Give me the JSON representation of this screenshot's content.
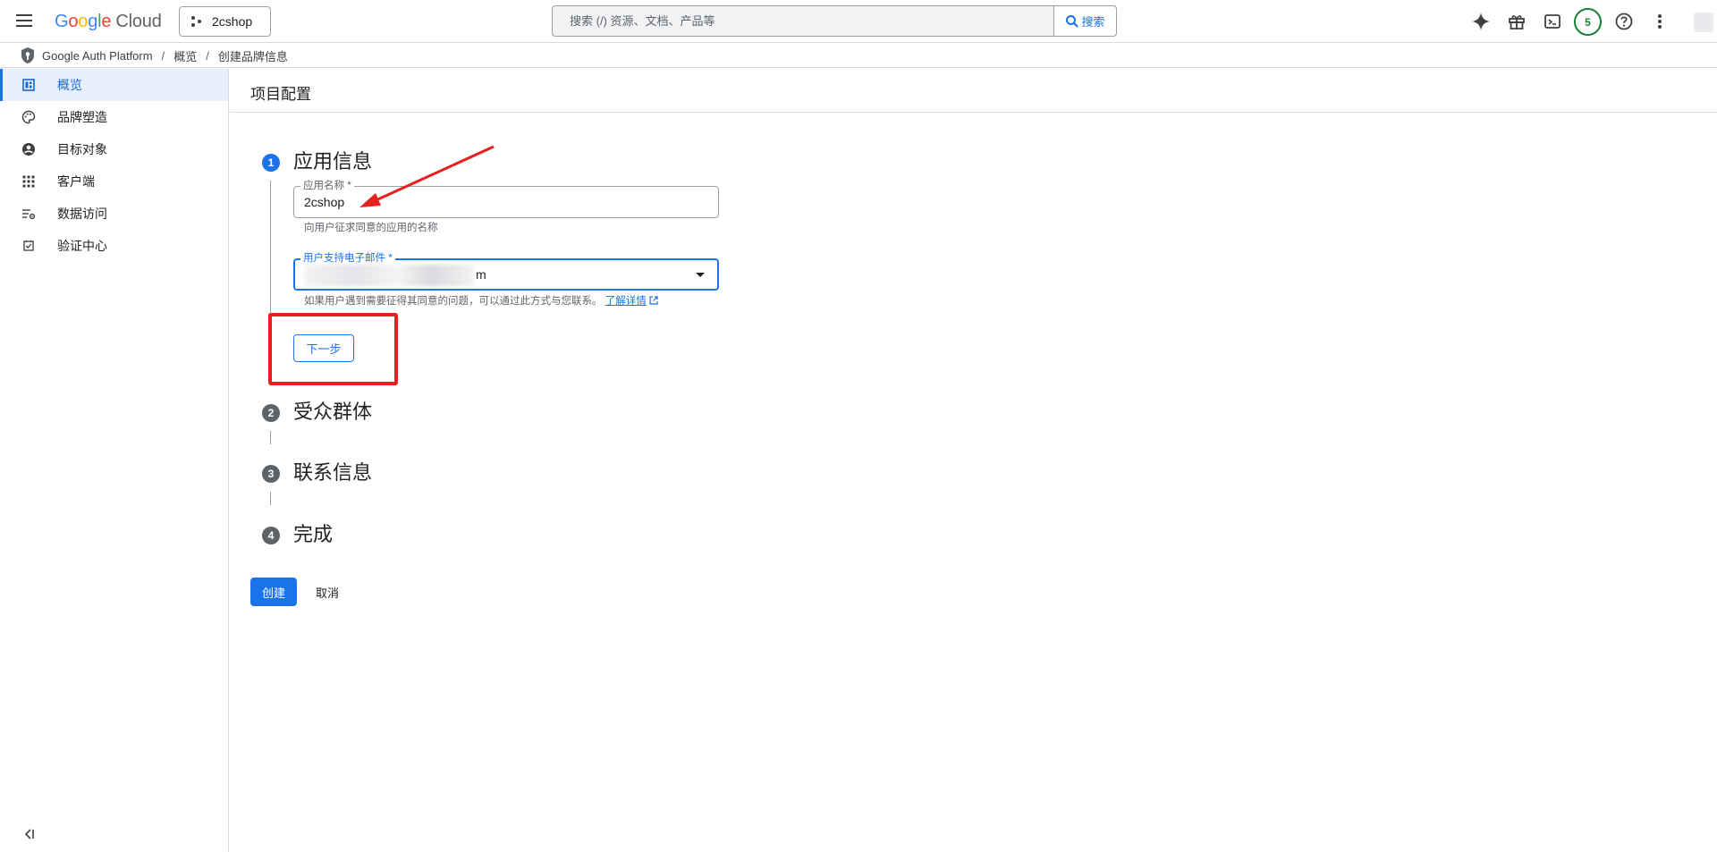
{
  "header": {
    "menu_icon": "hamburger-menu-icon",
    "logo": {
      "word": "Google",
      "suffix": "Cloud"
    },
    "project": "2cshop",
    "search": {
      "placeholder": "搜索 (/) 资源、文档、产品等",
      "button_label": "搜索"
    },
    "icons": [
      "gemini-sparkle-icon",
      "gift-icon",
      "cloud-shell-terminal-icon",
      "help-icon",
      "more-vert-icon"
    ],
    "notification_count": "5"
  },
  "breadcrumb": {
    "items": [
      "Google Auth Platform",
      "概览",
      "创建品牌信息"
    ],
    "separator": "/"
  },
  "sidebar": {
    "items": [
      {
        "label": "概览",
        "icon": "dashboard-icon",
        "active": true
      },
      {
        "label": "品牌塑造",
        "icon": "palette-icon",
        "active": false
      },
      {
        "label": "目标对象",
        "icon": "account-circle-icon",
        "active": false
      },
      {
        "label": "客户端",
        "icon": "apps-grid-icon",
        "active": false
      },
      {
        "label": "数据访问",
        "icon": "data-access-settings-icon",
        "active": false
      },
      {
        "label": "验证中心",
        "icon": "verification-checkbox-icon",
        "active": false
      }
    ],
    "collapse_icon": "collapse-sidebar-icon"
  },
  "page": {
    "title": "项目配置",
    "steps": [
      {
        "number": "1",
        "title": "应用信息",
        "active": true
      },
      {
        "number": "2",
        "title": "受众群体",
        "active": false
      },
      {
        "number": "3",
        "title": "联系信息",
        "active": false
      },
      {
        "number": "4",
        "title": "完成",
        "active": false
      }
    ],
    "app_name_field": {
      "label": "应用名称 *",
      "value": "2cshop",
      "hint": "向用户征求同意的应用的名称"
    },
    "support_email_field": {
      "label": "用户支持电子邮件 *",
      "value_visible_fragment": "m",
      "hint": "如果用户遇到需要征得其同意的问题，可以通过此方式与您联系。",
      "learn_more": "了解详情"
    },
    "next_button": "下一步",
    "create_button": "创建",
    "cancel_button": "取消"
  },
  "colors": {
    "primary": "#1a73e8",
    "annotation_red": "#e5201e",
    "active_nav_bg": "#e8f0fe",
    "notif_green": "#188038"
  }
}
